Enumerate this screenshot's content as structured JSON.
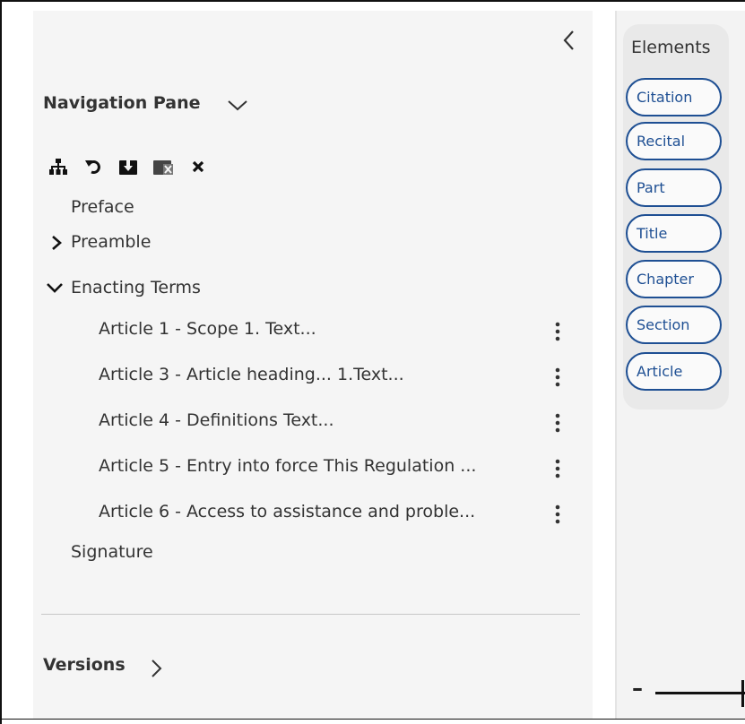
{
  "nav_pane": {
    "title": "Navigation Pane",
    "collapse_icon": "chevron-left-icon",
    "toolbar": [
      {
        "name": "hierarchy-icon"
      },
      {
        "name": "undo-icon"
      },
      {
        "name": "download-box-icon"
      },
      {
        "name": "remove-box-icon"
      },
      {
        "name": "close-icon"
      }
    ],
    "items": {
      "preface": "Preface",
      "preamble": "Preamble",
      "enacting_terms": "Enacting Terms",
      "articles": [
        "Article 1 - Scope 1. Text...",
        "Article 3 - Article heading... 1.Text...",
        "Article 4 - Definitions Text...",
        "Article 5 - Entry into force This Regulation ...",
        "Article 6 - Access to assistance and proble..."
      ],
      "signature": "Signature"
    }
  },
  "versions": {
    "title": "Versions"
  },
  "elements_panel": {
    "title": "Elements",
    "items": [
      "Citation",
      "Recital",
      "Part",
      "Title",
      "Chapter",
      "Section",
      "Article"
    ]
  },
  "colors": {
    "accent": "#1e4f93",
    "panel_bg": "#f5f5f5",
    "text": "#333333"
  }
}
